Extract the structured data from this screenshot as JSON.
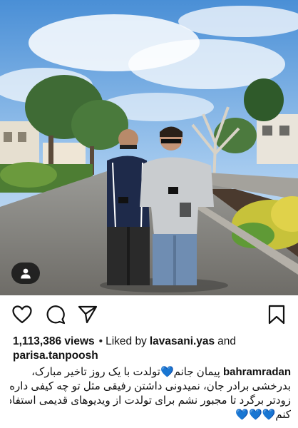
{
  "post": {
    "stats": {
      "views": "1,113,386 views",
      "separator": "•",
      "liked_by_prefix": "Liked by",
      "liked_user_1": "lavasani.yas",
      "and_text": "and",
      "liked_user_2": "parisa.tanpoosh"
    },
    "caption": {
      "author": "bahramradan",
      "line1_text": "پیمان جانم",
      "line1_rest": "تولدت با یک روز تاخیر مبارک،",
      "line2": "بدرخشی برادر جان، نمیدونی داشتن رفیقی مثل تو چه کیفی داره،",
      "line3": "زودتر برگرد تا مجبور نشم برای تولدت از ویدیوهای قدیمی استفاده",
      "line4_text": "کنم",
      "heart": "💙"
    },
    "icons": {
      "like": "heart-outline-icon",
      "comment": "comment-bubble-icon",
      "share": "paper-plane-icon",
      "save": "bookmark-icon",
      "tag": "person-tag-icon"
    },
    "colors": {
      "accent_heart": "#2aa8e0",
      "text": "#111111",
      "background": "#ffffff"
    }
  }
}
